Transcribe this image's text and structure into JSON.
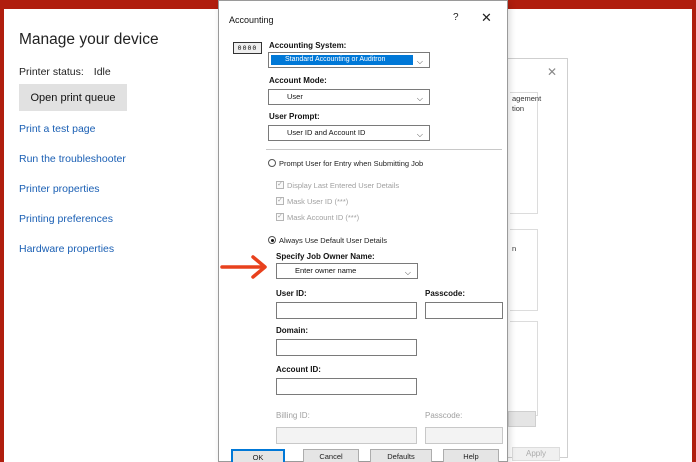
{
  "manage": {
    "title": "Manage your device",
    "status_label": "Printer status:",
    "status_value": "Idle",
    "open_queue": "Open print queue",
    "links": [
      "Print a test page",
      "Run the troubleshooter",
      "Printer properties",
      "Printing preferences",
      "Hardware properties"
    ]
  },
  "bg_dialog": {
    "close": "✕",
    "text1": "agement",
    "text2": "tion",
    "text3": "n",
    "apply": "Apply"
  },
  "accounting": {
    "title": "Accounting",
    "help": "?",
    "close": "✕",
    "icon_text": "0000",
    "system_label": "Accounting System:",
    "system_value": "Standard Accounting or Auditron",
    "mode_label": "Account Mode:",
    "mode_value": "User",
    "prompt_label": "User Prompt:",
    "prompt_value": "User ID and Account ID",
    "radio_prompt": "Prompt User for Entry when Submitting Job",
    "chk_display": "Display Last Entered User Details",
    "chk_mask_user": "Mask User ID (***)",
    "chk_mask_account": "Mask Account ID (***)",
    "radio_default": "Always Use Default User Details",
    "owner_label": "Specify Job Owner Name:",
    "owner_value": "Enter owner name",
    "userid_label": "User ID:",
    "passcode_label": "Passcode:",
    "domain_label": "Domain:",
    "accountid_label": "Account ID:",
    "billing_label": "Billing ID:",
    "billing_passcode_label": "Passcode:",
    "buttons": {
      "ok": "OK",
      "cancel": "Cancel",
      "defaults": "Defaults",
      "help": "Help"
    }
  },
  "colors": {
    "frame": "#b01e0e",
    "arrow": "#e8411d",
    "link": "#1a5fb4",
    "highlight": "#0078d7"
  }
}
